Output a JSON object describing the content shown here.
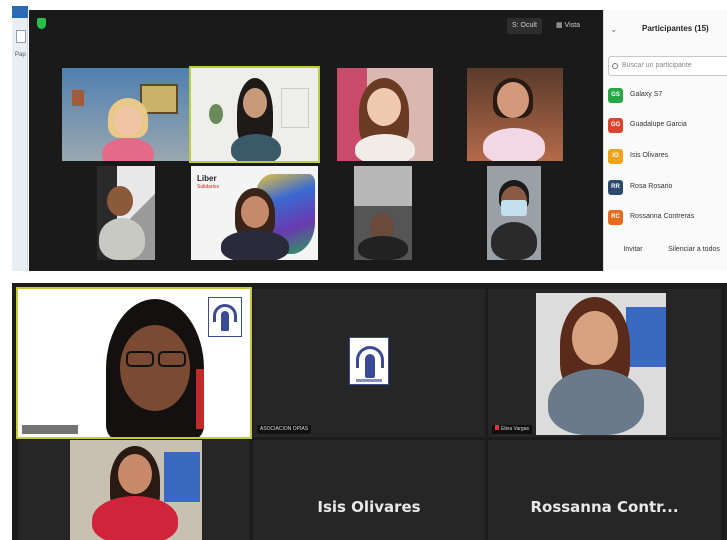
{
  "top": {
    "edge_label": "Pap",
    "view_buttons": {
      "speaker": "S: Ocult",
      "grid": "▦ Vista"
    },
    "participants_panel": {
      "title": "Participantes (15)",
      "search_placeholder": "Buscar un participante",
      "participants": [
        {
          "initials": "GS",
          "name": "Galaxy S7",
          "color": "#27a844"
        },
        {
          "initials": "GG",
          "name": "Guadalupe Garcia",
          "color": "#d9442e"
        },
        {
          "initials": "IO",
          "name": "Isis Olivares",
          "color": "#f0a21a"
        },
        {
          "initials": "RR",
          "name": "Rosa Rosario",
          "color": "#2c4a6e"
        },
        {
          "initials": "RC",
          "name": "Rossanna Contreras",
          "color": "#ea6a1d"
        }
      ],
      "invite_label": "Invitar",
      "mute_all_label": "Silenciar a todos"
    },
    "tile_labels": {
      "liber": "Liber",
      "liber_sub": "Sulidarios"
    }
  },
  "bottom": {
    "tiles": {
      "speaker_tag": "",
      "logo_tag": "ASOCIACION OPIAS",
      "woman_right_tag": "Elina Vargas",
      "isis": "Isis Olivares",
      "rossanna": "Rossanna  Contr..."
    }
  },
  "colors": {
    "active_outline": "#b8cf3a",
    "tile_bg": "#242424",
    "accent_green": "#27c04a"
  }
}
